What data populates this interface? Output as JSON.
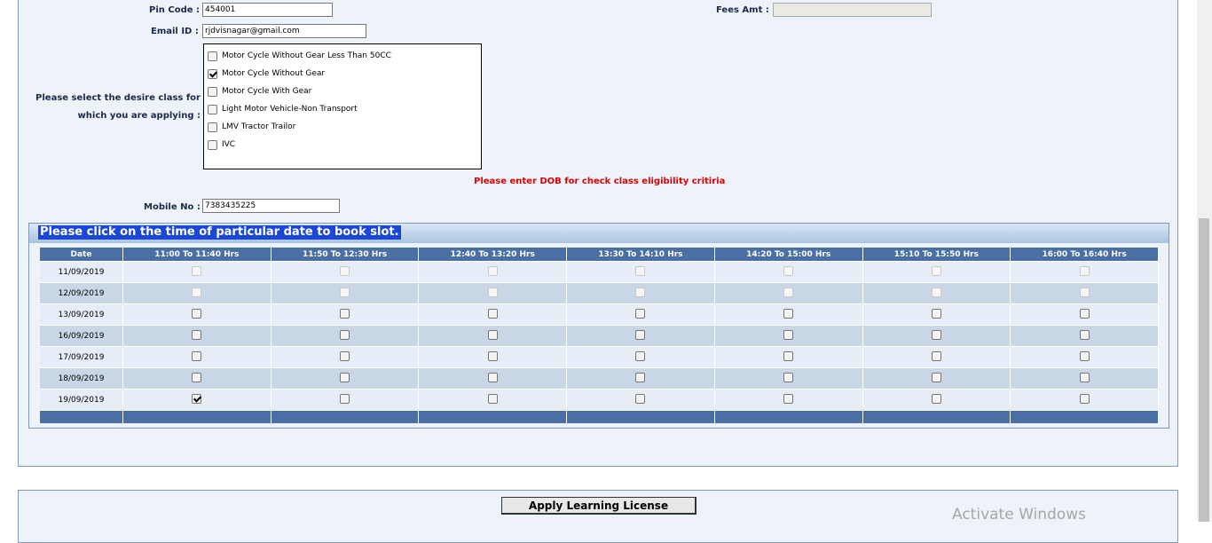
{
  "form": {
    "pin_code_label": "Pin Code :",
    "pin_code_value": "454001",
    "fees_amt_label": "Fees Amt :",
    "fees_amt_value": "",
    "email_label": "Email ID :",
    "email_value": "rjdvisnagar@gmail.com",
    "class_label_line1": "Please select the desire class for",
    "class_label_line2": "which you are applying :",
    "classes": [
      {
        "label": "Motor Cycle Without Gear Less Than 50CC",
        "checked": false
      },
      {
        "label": "Motor Cycle Without Gear",
        "checked": true
      },
      {
        "label": "Motor Cycle With Gear",
        "checked": false
      },
      {
        "label": "Light Motor Vehicle-Non Transport",
        "checked": false
      },
      {
        "label": "LMV Tractor Trailor",
        "checked": false
      },
      {
        "label": "IVC",
        "checked": false
      }
    ],
    "dob_warning": "Please enter DOB for check class eligibility critiria",
    "mobile_label": "Mobile No :",
    "mobile_value": "7383435225"
  },
  "slots": {
    "heading": "Please click on the time of particular date to book slot.",
    "columns": [
      "Date",
      "11:00 To 11:40 Hrs",
      "11:50 To 12:30 Hrs",
      "12:40 To 13:20 Hrs",
      "13:30 To 14:10 Hrs",
      "14:20 To 15:00 Hrs",
      "15:10 To 15:50 Hrs",
      "16:00 To 16:40 Hrs"
    ],
    "rows": [
      {
        "date": "11/09/2019",
        "disabled": true,
        "checked": [
          false,
          false,
          false,
          false,
          false,
          false,
          false
        ]
      },
      {
        "date": "12/09/2019",
        "disabled": true,
        "checked": [
          false,
          false,
          false,
          false,
          false,
          false,
          false
        ]
      },
      {
        "date": "13/09/2019",
        "disabled": false,
        "checked": [
          false,
          false,
          false,
          false,
          false,
          false,
          false
        ]
      },
      {
        "date": "16/09/2019",
        "disabled": false,
        "checked": [
          false,
          false,
          false,
          false,
          false,
          false,
          false
        ]
      },
      {
        "date": "17/09/2019",
        "disabled": false,
        "checked": [
          false,
          false,
          false,
          false,
          false,
          false,
          false
        ]
      },
      {
        "date": "18/09/2019",
        "disabled": false,
        "checked": [
          false,
          false,
          false,
          false,
          false,
          false,
          false
        ]
      },
      {
        "date": "19/09/2019",
        "disabled": false,
        "checked": [
          true,
          false,
          false,
          false,
          false,
          false,
          false
        ]
      }
    ]
  },
  "actions": {
    "apply_label": "Apply Learning License"
  },
  "system": {
    "watermark": "Activate Windows"
  }
}
